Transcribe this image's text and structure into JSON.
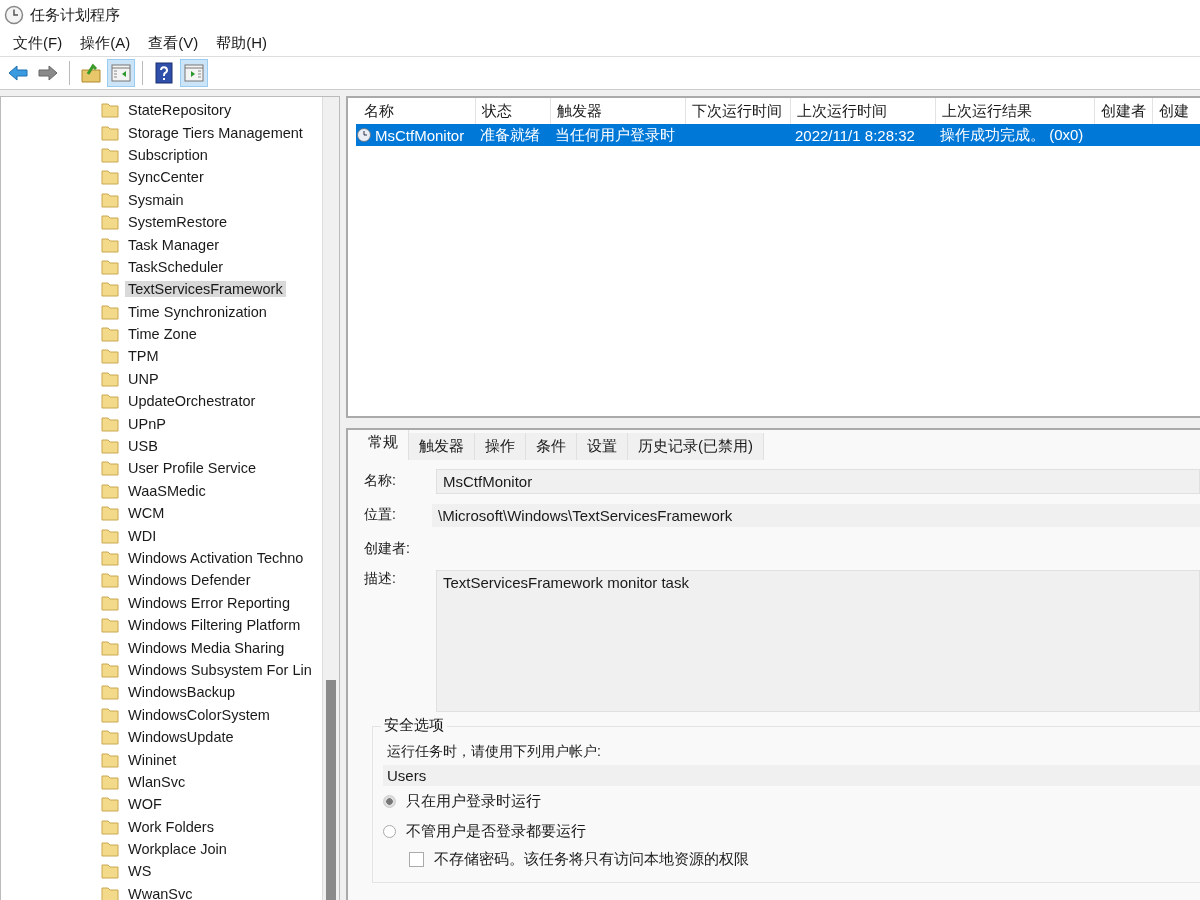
{
  "window": {
    "title": "任务计划程序"
  },
  "menu": [
    "文件(F)",
    "操作(A)",
    "查看(V)",
    "帮助(H)"
  ],
  "toolbar": [
    [
      {
        "kind": "back",
        "on": false
      },
      {
        "kind": "forward",
        "on": false
      }
    ],
    [
      {
        "kind": "up",
        "on": false
      },
      {
        "kind": "tree",
        "on": true
      }
    ],
    [
      {
        "kind": "help",
        "on": false
      },
      {
        "kind": "actions",
        "on": true
      }
    ]
  ],
  "tree": {
    "items": [
      {
        "label": "StateRepository",
        "selected": false
      },
      {
        "label": "Storage Tiers Management",
        "selected": false
      },
      {
        "label": "Subscription",
        "selected": false
      },
      {
        "label": "SyncCenter",
        "selected": false
      },
      {
        "label": "Sysmain",
        "selected": false
      },
      {
        "label": "SystemRestore",
        "selected": false
      },
      {
        "label": "Task Manager",
        "selected": false
      },
      {
        "label": "TaskScheduler",
        "selected": false
      },
      {
        "label": "TextServicesFramework",
        "selected": true
      },
      {
        "label": "Time Synchronization",
        "selected": false
      },
      {
        "label": "Time Zone",
        "selected": false
      },
      {
        "label": "TPM",
        "selected": false
      },
      {
        "label": "UNP",
        "selected": false
      },
      {
        "label": "UpdateOrchestrator",
        "selected": false
      },
      {
        "label": "UPnP",
        "selected": false
      },
      {
        "label": "USB",
        "selected": false
      },
      {
        "label": "User Profile Service",
        "selected": false
      },
      {
        "label": "WaaSMedic",
        "selected": false
      },
      {
        "label": "WCM",
        "selected": false
      },
      {
        "label": "WDI",
        "selected": false
      },
      {
        "label": "Windows Activation Techno",
        "selected": false
      },
      {
        "label": "Windows Defender",
        "selected": false
      },
      {
        "label": "Windows Error Reporting",
        "selected": false
      },
      {
        "label": "Windows Filtering Platform",
        "selected": false
      },
      {
        "label": "Windows Media Sharing",
        "selected": false
      },
      {
        "label": "Windows Subsystem For Lin",
        "selected": false
      },
      {
        "label": "WindowsBackup",
        "selected": false
      },
      {
        "label": "WindowsColorSystem",
        "selected": false
      },
      {
        "label": "WindowsUpdate",
        "selected": false
      },
      {
        "label": "Wininet",
        "selected": false
      },
      {
        "label": "WlanSvc",
        "selected": false
      },
      {
        "label": "WOF",
        "selected": false
      },
      {
        "label": "Work Folders",
        "selected": false
      },
      {
        "label": "Workplace Join",
        "selected": false
      },
      {
        "label": "WS",
        "selected": false
      },
      {
        "label": "WwanSvc",
        "selected": false
      }
    ]
  },
  "task_list": {
    "columns": [
      "名称",
      "状态",
      "触发器",
      "下次运行时间",
      "上次运行时间",
      "上次运行结果",
      "创建者",
      "创建"
    ],
    "rows": [
      {
        "selected": true,
        "name": "MsCtfMonitor",
        "status": "准备就绪",
        "trigger": "当任何用户登录时",
        "last_run": "2022/11/1 8:28:32",
        "last_result": "操作成功完成。 (0x0)"
      }
    ]
  },
  "tabs": [
    {
      "label": "常规",
      "selected": true
    },
    {
      "label": "触发器",
      "selected": false
    },
    {
      "label": "操作",
      "selected": false
    },
    {
      "label": "条件",
      "selected": false
    },
    {
      "label": "设置",
      "selected": false
    },
    {
      "label": "历史记录(已禁用)",
      "selected": false
    }
  ],
  "general": {
    "name_label": "名称:",
    "name_value": "MsCtfMonitor",
    "location_label": "位置:",
    "location_value": "\\Microsoft\\Windows\\TextServicesFramework",
    "author_label": "创建者:",
    "description_label": "描述:",
    "description_value": "TextServicesFramework monitor task"
  },
  "security": {
    "title": "安全选项",
    "account_label": "运行任务时，请使用下列用户帐户:",
    "account_value": "Users",
    "options": [
      {
        "kind": "radio",
        "label": "只在用户登录时运行",
        "selected": true
      },
      {
        "kind": "radio",
        "label": "不管用户是否登录都要运行",
        "selected": false
      },
      {
        "kind": "checkbox",
        "label": "不存储密码。该任务将只有访问本地资源的权限",
        "checked": false
      }
    ]
  }
}
